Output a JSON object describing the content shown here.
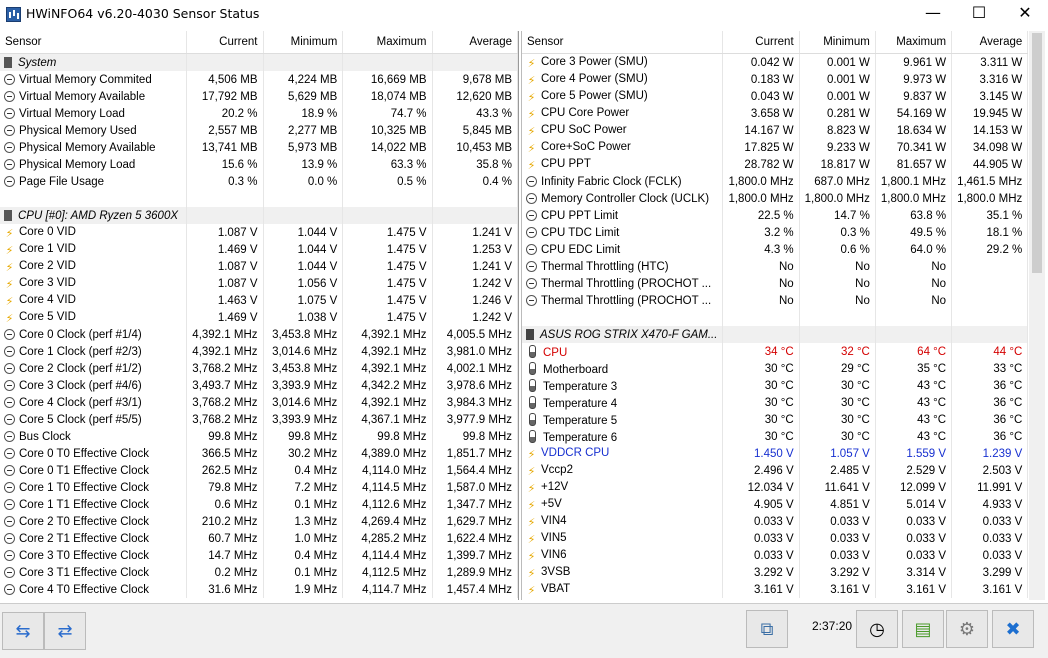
{
  "window": {
    "title": "HWiNFO64 v6.20-4030 Sensor Status",
    "minimize": "—",
    "maximize": "☐",
    "close": "✕"
  },
  "columns": {
    "sensor": "Sensor",
    "current": "Current",
    "minimum": "Minimum",
    "maximum": "Maximum",
    "average": "Average"
  },
  "left_rows": [
    {
      "type": "group",
      "icon": "chip",
      "name": "System"
    },
    {
      "icon": "gauge",
      "name": "Virtual Memory Commited",
      "cur": "4,506 MB",
      "min": "4,224 MB",
      "max": "16,669 MB",
      "avg": "9,678 MB"
    },
    {
      "icon": "gauge",
      "name": "Virtual Memory Available",
      "cur": "17,792 MB",
      "min": "5,629 MB",
      "max": "18,074 MB",
      "avg": "12,620 MB"
    },
    {
      "icon": "gauge",
      "name": "Virtual Memory Load",
      "cur": "20.2 %",
      "min": "18.9 %",
      "max": "74.7 %",
      "avg": "43.3 %"
    },
    {
      "icon": "gauge",
      "name": "Physical Memory Used",
      "cur": "2,557 MB",
      "min": "2,277 MB",
      "max": "10,325 MB",
      "avg": "5,845 MB"
    },
    {
      "icon": "gauge",
      "name": "Physical Memory Available",
      "cur": "13,741 MB",
      "min": "5,973 MB",
      "max": "14,022 MB",
      "avg": "10,453 MB"
    },
    {
      "icon": "gauge",
      "name": "Physical Memory Load",
      "cur": "15.6 %",
      "min": "13.9 %",
      "max": "63.3 %",
      "avg": "35.8 %"
    },
    {
      "icon": "gauge",
      "name": "Page File Usage",
      "cur": "0.3 %",
      "min": "0.0 %",
      "max": "0.5 %",
      "avg": "0.4 %"
    },
    {
      "type": "spacer"
    },
    {
      "type": "group",
      "icon": "chip",
      "name": "CPU [#0]: AMD Ryzen 5 3600X"
    },
    {
      "icon": "bolt",
      "name": "Core 0 VID",
      "cur": "1.087 V",
      "min": "1.044 V",
      "max": "1.475 V",
      "avg": "1.241 V"
    },
    {
      "icon": "bolt",
      "name": "Core 1 VID",
      "cur": "1.469 V",
      "min": "1.044 V",
      "max": "1.475 V",
      "avg": "1.253 V"
    },
    {
      "icon": "bolt",
      "name": "Core 2 VID",
      "cur": "1.087 V",
      "min": "1.044 V",
      "max": "1.475 V",
      "avg": "1.241 V"
    },
    {
      "icon": "bolt",
      "name": "Core 3 VID",
      "cur": "1.087 V",
      "min": "1.056 V",
      "max": "1.475 V",
      "avg": "1.242 V"
    },
    {
      "icon": "bolt",
      "name": "Core 4 VID",
      "cur": "1.463 V",
      "min": "1.075 V",
      "max": "1.475 V",
      "avg": "1.246 V"
    },
    {
      "icon": "bolt",
      "name": "Core 5 VID",
      "cur": "1.469 V",
      "min": "1.038 V",
      "max": "1.475 V",
      "avg": "1.242 V"
    },
    {
      "icon": "gauge",
      "name": "Core 0 Clock (perf #1/4)",
      "cur": "4,392.1 MHz",
      "min": "3,453.8 MHz",
      "max": "4,392.1 MHz",
      "avg": "4,005.5 MHz"
    },
    {
      "icon": "gauge",
      "name": "Core 1 Clock (perf #2/3)",
      "cur": "4,392.1 MHz",
      "min": "3,014.6 MHz",
      "max": "4,392.1 MHz",
      "avg": "3,981.0 MHz"
    },
    {
      "icon": "gauge",
      "name": "Core 2 Clock (perf #1/2)",
      "cur": "3,768.2 MHz",
      "min": "3,453.8 MHz",
      "max": "4,392.1 MHz",
      "avg": "4,002.1 MHz"
    },
    {
      "icon": "gauge",
      "name": "Core 3 Clock (perf #4/6)",
      "cur": "3,493.7 MHz",
      "min": "3,393.9 MHz",
      "max": "4,342.2 MHz",
      "avg": "3,978.6 MHz"
    },
    {
      "icon": "gauge",
      "name": "Core 4 Clock (perf #3/1)",
      "cur": "3,768.2 MHz",
      "min": "3,014.6 MHz",
      "max": "4,392.1 MHz",
      "avg": "3,984.3 MHz"
    },
    {
      "icon": "gauge",
      "name": "Core 5 Clock (perf #5/5)",
      "cur": "3,768.2 MHz",
      "min": "3,393.9 MHz",
      "max": "4,367.1 MHz",
      "avg": "3,977.9 MHz"
    },
    {
      "icon": "gauge",
      "name": "Bus Clock",
      "cur": "99.8 MHz",
      "min": "99.8 MHz",
      "max": "99.8 MHz",
      "avg": "99.8 MHz"
    },
    {
      "icon": "gauge",
      "name": "Core 0 T0 Effective Clock",
      "cur": "366.5 MHz",
      "min": "30.2 MHz",
      "max": "4,389.0 MHz",
      "avg": "1,851.7 MHz"
    },
    {
      "icon": "gauge",
      "name": "Core 0 T1 Effective Clock",
      "cur": "262.5 MHz",
      "min": "0.4 MHz",
      "max": "4,114.0 MHz",
      "avg": "1,564.4 MHz"
    },
    {
      "icon": "gauge",
      "name": "Core 1 T0 Effective Clock",
      "cur": "79.8 MHz",
      "min": "7.2 MHz",
      "max": "4,114.5 MHz",
      "avg": "1,587.0 MHz"
    },
    {
      "icon": "gauge",
      "name": "Core 1 T1 Effective Clock",
      "cur": "0.6 MHz",
      "min": "0.1 MHz",
      "max": "4,112.6 MHz",
      "avg": "1,347.7 MHz"
    },
    {
      "icon": "gauge",
      "name": "Core 2 T0 Effective Clock",
      "cur": "210.2 MHz",
      "min": "1.3 MHz",
      "max": "4,269.4 MHz",
      "avg": "1,629.7 MHz"
    },
    {
      "icon": "gauge",
      "name": "Core 2 T1 Effective Clock",
      "cur": "60.7 MHz",
      "min": "1.0 MHz",
      "max": "4,285.2 MHz",
      "avg": "1,622.4 MHz"
    },
    {
      "icon": "gauge",
      "name": "Core 3 T0 Effective Clock",
      "cur": "14.7 MHz",
      "min": "0.4 MHz",
      "max": "4,114.4 MHz",
      "avg": "1,399.7 MHz"
    },
    {
      "icon": "gauge",
      "name": "Core 3 T1 Effective Clock",
      "cur": "0.2 MHz",
      "min": "0.1 MHz",
      "max": "4,112.5 MHz",
      "avg": "1,289.9 MHz"
    },
    {
      "icon": "gauge",
      "name": "Core 4 T0 Effective Clock",
      "cur": "31.6 MHz",
      "min": "1.9 MHz",
      "max": "4,114.7 MHz",
      "avg": "1,457.4 MHz"
    }
  ],
  "right_rows": [
    {
      "icon": "bolt",
      "name": "Core 3 Power (SMU)",
      "cur": "0.042 W",
      "min": "0.001 W",
      "max": "9.961 W",
      "avg": "3.311 W"
    },
    {
      "icon": "bolt",
      "name": "Core 4 Power (SMU)",
      "cur": "0.183 W",
      "min": "0.001 W",
      "max": "9.973 W",
      "avg": "3.316 W"
    },
    {
      "icon": "bolt",
      "name": "Core 5 Power (SMU)",
      "cur": "0.043 W",
      "min": "0.001 W",
      "max": "9.837 W",
      "avg": "3.145 W"
    },
    {
      "icon": "bolt",
      "name": "CPU Core Power",
      "cur": "3.658 W",
      "min": "0.281 W",
      "max": "54.169 W",
      "avg": "19.945 W"
    },
    {
      "icon": "bolt",
      "name": "CPU SoC Power",
      "cur": "14.167 W",
      "min": "8.823 W",
      "max": "18.634 W",
      "avg": "14.153 W"
    },
    {
      "icon": "bolt",
      "name": "Core+SoC Power",
      "cur": "17.825 W",
      "min": "9.233 W",
      "max": "70.341 W",
      "avg": "34.098 W"
    },
    {
      "icon": "bolt",
      "name": "CPU PPT",
      "cur": "28.782 W",
      "min": "18.817 W",
      "max": "81.657 W",
      "avg": "44.905 W"
    },
    {
      "icon": "gauge",
      "name": "Infinity Fabric Clock (FCLK)",
      "cur": "1,800.0 MHz",
      "min": "687.0 MHz",
      "max": "1,800.1 MHz",
      "avg": "1,461.5 MHz"
    },
    {
      "icon": "gauge",
      "name": "Memory Controller Clock (UCLK)",
      "cur": "1,800.0 MHz",
      "min": "1,800.0 MHz",
      "max": "1,800.0 MHz",
      "avg": "1,800.0 MHz"
    },
    {
      "icon": "gauge",
      "name": "CPU PPT Limit",
      "cur": "22.5 %",
      "min": "14.7 %",
      "max": "63.8 %",
      "avg": "35.1 %"
    },
    {
      "icon": "gauge",
      "name": "CPU TDC Limit",
      "cur": "3.2 %",
      "min": "0.3 %",
      "max": "49.5 %",
      "avg": "18.1 %"
    },
    {
      "icon": "gauge",
      "name": "CPU EDC Limit",
      "cur": "4.3 %",
      "min": "0.6 %",
      "max": "64.0 %",
      "avg": "29.2 %"
    },
    {
      "icon": "gauge",
      "name": "Thermal Throttling (HTC)",
      "cur": "No",
      "min": "No",
      "max": "No",
      "avg": ""
    },
    {
      "icon": "gauge",
      "name": "Thermal Throttling (PROCHOT ...",
      "cur": "No",
      "min": "No",
      "max": "No",
      "avg": ""
    },
    {
      "icon": "gauge",
      "name": "Thermal Throttling (PROCHOT ...",
      "cur": "No",
      "min": "No",
      "max": "No",
      "avg": ""
    },
    {
      "type": "spacer"
    },
    {
      "type": "group",
      "icon": "board",
      "name": "ASUS ROG STRIX X470-F GAM..."
    },
    {
      "icon": "therm",
      "name": "CPU",
      "cur": "34 °C",
      "min": "32 °C",
      "max": "64 °C",
      "avg": "44 °C",
      "color": "red"
    },
    {
      "icon": "therm",
      "name": "Motherboard",
      "cur": "30 °C",
      "min": "29 °C",
      "max": "35 °C",
      "avg": "33 °C"
    },
    {
      "icon": "therm",
      "name": "Temperature 3",
      "cur": "30 °C",
      "min": "30 °C",
      "max": "43 °C",
      "avg": "36 °C"
    },
    {
      "icon": "therm",
      "name": "Temperature 4",
      "cur": "30 °C",
      "min": "30 °C",
      "max": "43 °C",
      "avg": "36 °C"
    },
    {
      "icon": "therm",
      "name": "Temperature 5",
      "cur": "30 °C",
      "min": "30 °C",
      "max": "43 °C",
      "avg": "36 °C"
    },
    {
      "icon": "therm",
      "name": "Temperature 6",
      "cur": "30 °C",
      "min": "30 °C",
      "max": "43 °C",
      "avg": "36 °C"
    },
    {
      "icon": "bolt",
      "name": "VDDCR CPU",
      "cur": "1.450 V",
      "min": "1.057 V",
      "max": "1.559 V",
      "avg": "1.239 V",
      "color": "blue"
    },
    {
      "icon": "bolt",
      "name": "Vccp2",
      "cur": "2.496 V",
      "min": "2.485 V",
      "max": "2.529 V",
      "avg": "2.503 V"
    },
    {
      "icon": "bolt",
      "name": "+12V",
      "cur": "12.034 V",
      "min": "11.641 V",
      "max": "12.099 V",
      "avg": "11.991 V"
    },
    {
      "icon": "bolt",
      "name": "+5V",
      "cur": "4.905 V",
      "min": "4.851 V",
      "max": "5.014 V",
      "avg": "4.933 V"
    },
    {
      "icon": "bolt",
      "name": "VIN4",
      "cur": "0.033 V",
      "min": "0.033 V",
      "max": "0.033 V",
      "avg": "0.033 V"
    },
    {
      "icon": "bolt",
      "name": "VIN5",
      "cur": "0.033 V",
      "min": "0.033 V",
      "max": "0.033 V",
      "avg": "0.033 V"
    },
    {
      "icon": "bolt",
      "name": "VIN6",
      "cur": "0.033 V",
      "min": "0.033 V",
      "max": "0.033 V",
      "avg": "0.033 V"
    },
    {
      "icon": "bolt",
      "name": "3VSB",
      "cur": "3.292 V",
      "min": "3.292 V",
      "max": "3.314 V",
      "avg": "3.299 V"
    },
    {
      "icon": "bolt",
      "name": "VBAT",
      "cur": "3.161 V",
      "min": "3.161 V",
      "max": "3.161 V",
      "avg": "3.161 V"
    }
  ],
  "bottom": {
    "nav_expand_icon": "arrows-expand-icon",
    "nav_collapse_icon": "arrows-collapse-icon",
    "elapsed_time": "2:37:20"
  }
}
